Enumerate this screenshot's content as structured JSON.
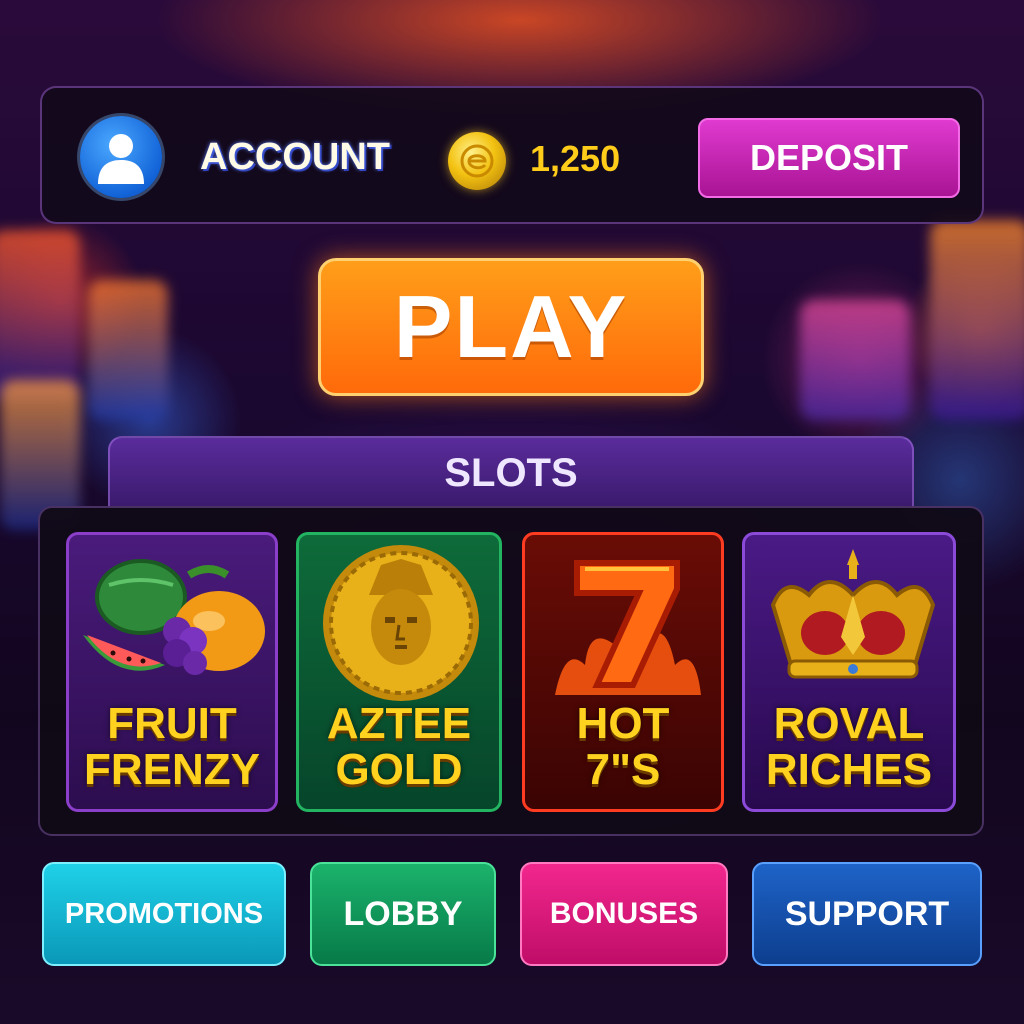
{
  "header": {
    "account_label": "ACCOUNT",
    "balance": "1,250",
    "deposit_label": "DEPOSIT",
    "avatar_icon": "user-avatar-icon",
    "coin_icon": "coin-icon"
  },
  "play_label": "PLAY",
  "slots": {
    "title": "SLOTS",
    "games": [
      {
        "line1": "FRUIT",
        "line2": "FRENZY",
        "icon": "fruit-icon",
        "color": "#8a3ec9"
      },
      {
        "line1": "AZTEE",
        "line2": "GOLD",
        "icon": "aztec-coin-icon",
        "color": "#22b461"
      },
      {
        "line1": "HOT",
        "line2": "7\"S",
        "icon": "lucky-seven-icon",
        "color": "#ff3c22"
      },
      {
        "line1": "ROVAL",
        "line2": "RICHES",
        "icon": "crown-icon",
        "color": "#8b4ad8"
      }
    ]
  },
  "nav": {
    "promotions": "PROMOTIONS",
    "lobby": "LOBBY",
    "bonuses": "BONUSES",
    "support": "SUPPORT"
  },
  "colors": {
    "play": "#ff7a0f",
    "deposit": "#c824b4",
    "balance": "#ffcc1a"
  }
}
